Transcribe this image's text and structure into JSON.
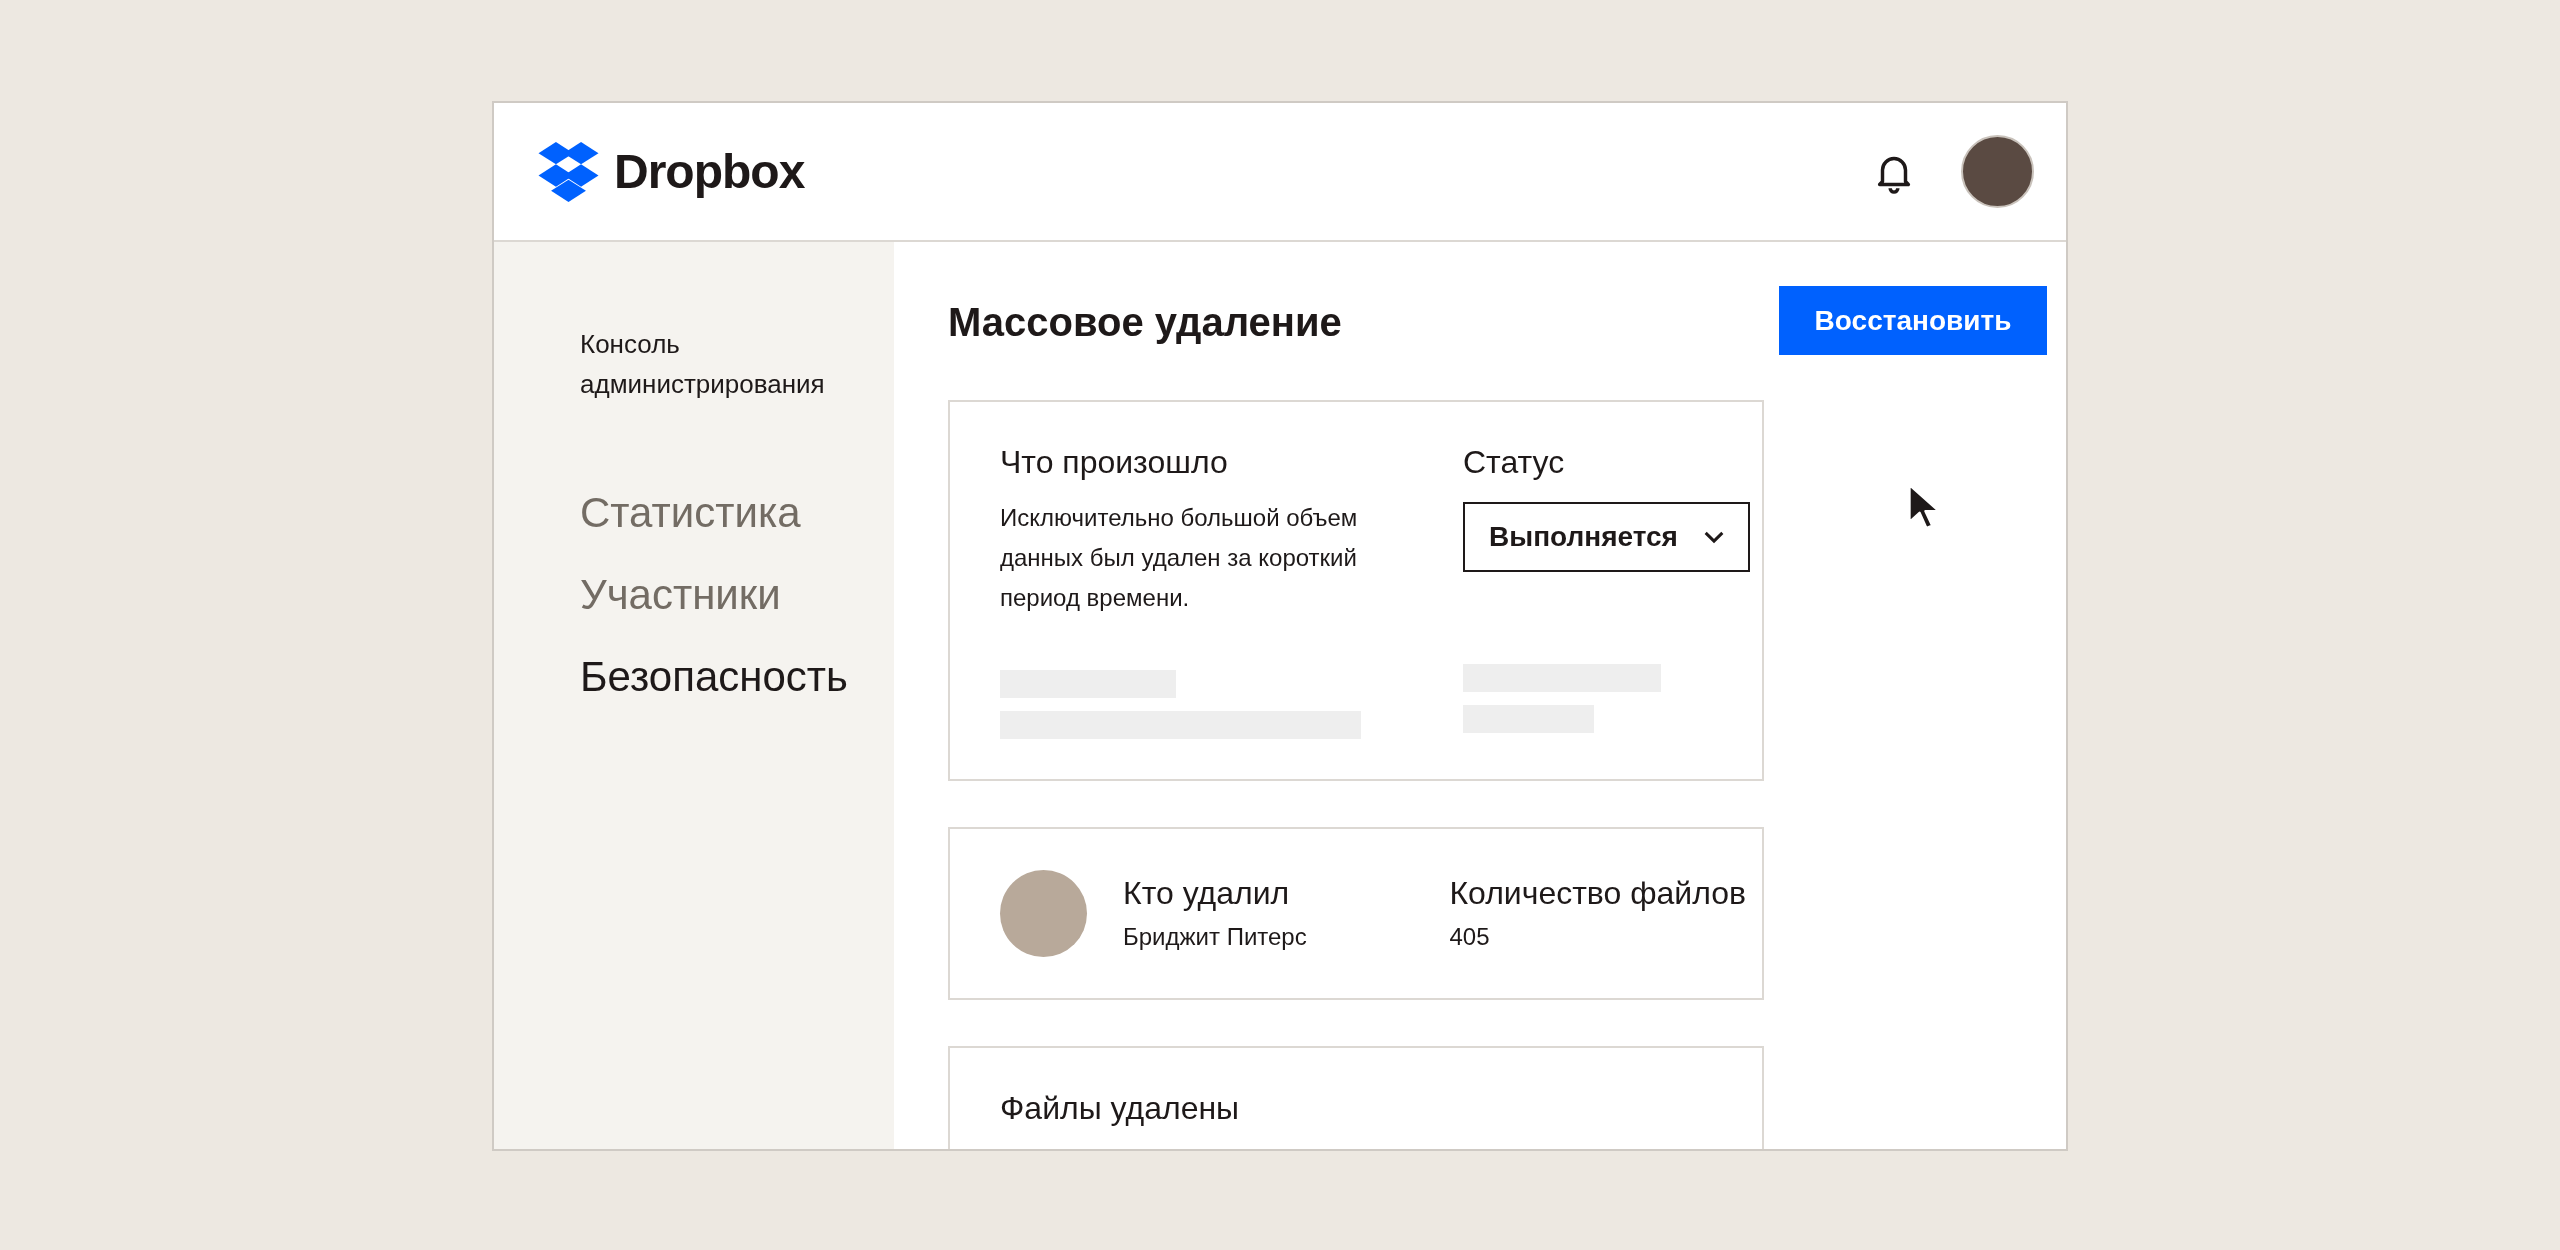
{
  "header": {
    "logo_text": "Dropbox"
  },
  "sidebar": {
    "title": "Консоль администрирования",
    "items": [
      {
        "label": "Статистика",
        "selected": false
      },
      {
        "label": "Участники",
        "selected": false
      },
      {
        "label": "Безопасность",
        "selected": true
      }
    ]
  },
  "main": {
    "title": "Массовое удаление",
    "restore_button": "Восстановить",
    "incident_card": {
      "what_heading": "Что произошло",
      "what_text": "Исключительно большой объем данных был удален за короткий период времени.",
      "status_heading": "Статус",
      "status_value": "Выполняется"
    },
    "deleter_card": {
      "who_heading": "Кто удалил",
      "who_name": "Бриджит Питерс",
      "count_heading": "Количество файлов",
      "count_value": "405"
    },
    "files_card": {
      "heading": "Файлы удалены"
    }
  }
}
